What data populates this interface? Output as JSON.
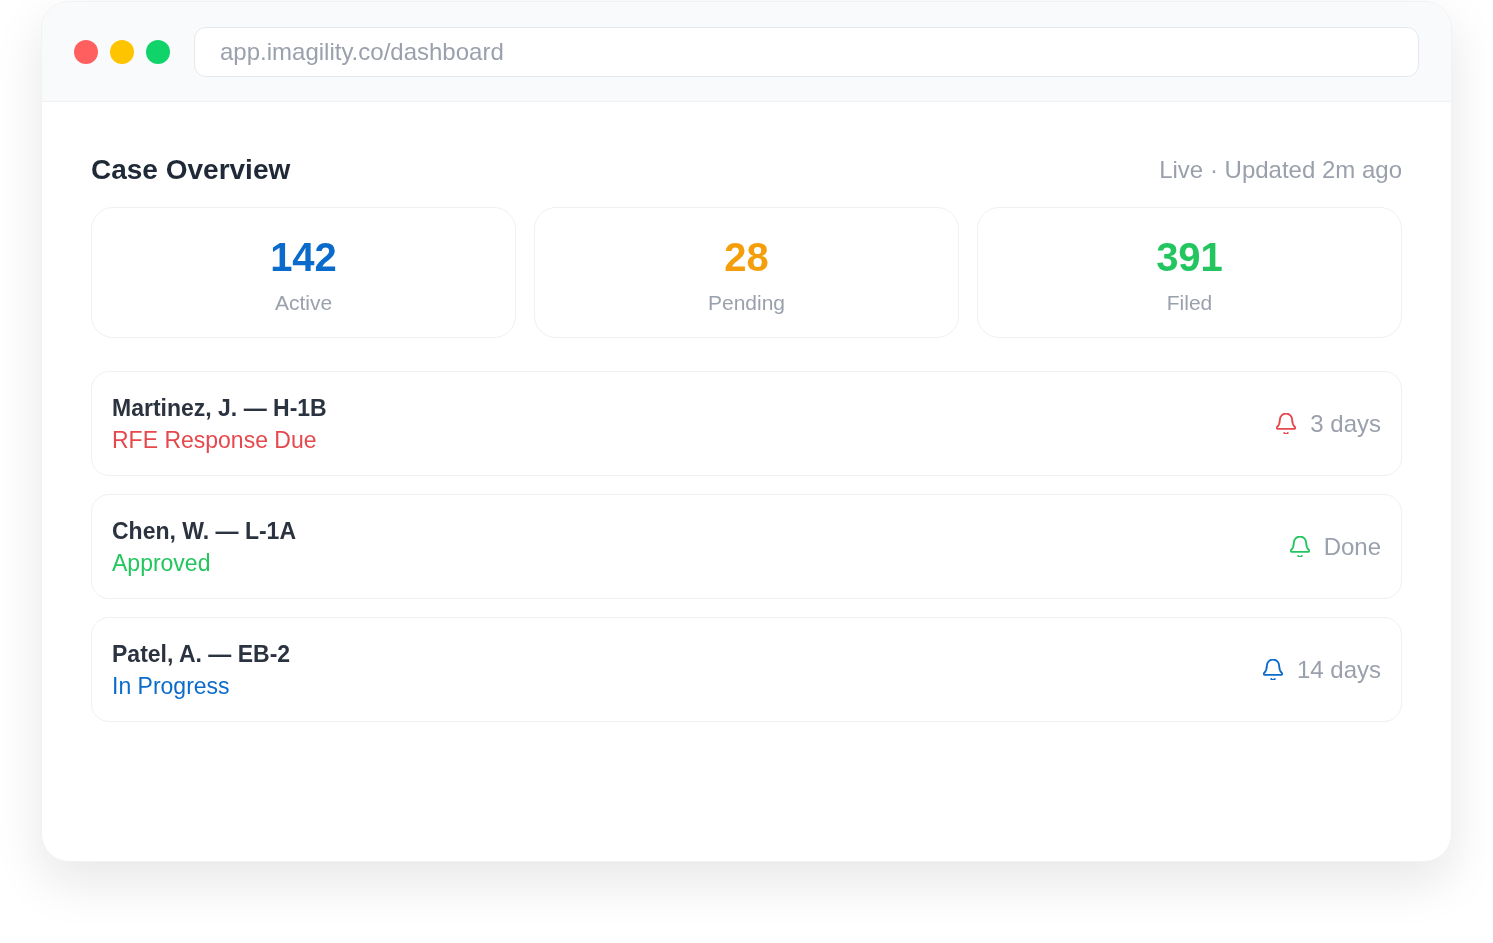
{
  "window": {
    "controls": [
      {
        "color": "#ff5f5f"
      },
      {
        "color": "#ffc400"
      },
      {
        "color": "#10d46a"
      }
    ],
    "address": "app.imagility.co/dashboard"
  },
  "header": {
    "title": "Case Overview",
    "status": "Live · Updated 2m ago"
  },
  "stats": [
    {
      "value": "142",
      "label": "Active",
      "color": "#0b6bcb"
    },
    {
      "value": "28",
      "label": "Pending",
      "color": "#f59e0b"
    },
    {
      "value": "391",
      "label": "Filed",
      "color": "#22c55e"
    }
  ],
  "cases": [
    {
      "title": "Martinez, J. — H-1B",
      "status": "RFE Response Due",
      "color": "#e5484d",
      "due": "3 days"
    },
    {
      "title": "Chen, W. — L-1A",
      "status": "Approved",
      "color": "#22c55e",
      "due": "Done"
    },
    {
      "title": "Patel, A. — EB-2",
      "status": "In Progress",
      "color": "#0b6bcb",
      "due": "14 days"
    }
  ]
}
